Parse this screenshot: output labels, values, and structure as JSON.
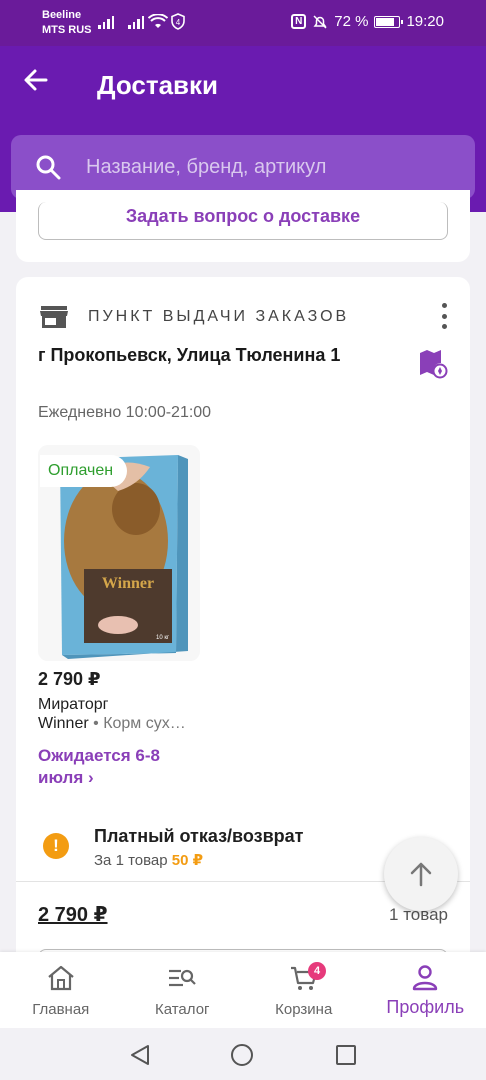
{
  "status_bar": {
    "carrier_1": "Beeline",
    "carrier_2": "MTS RUS",
    "battery": "72 %",
    "time": "19:20",
    "battery_level": 0.72
  },
  "header": {
    "title": "Доставки",
    "search_placeholder": "Название, бренд, артикул"
  },
  "prev_card": {
    "ask_button": "Задать вопрос о доставке"
  },
  "pickup": {
    "label": "ПУНКТ ВЫДАЧИ ЗАКАЗОВ",
    "address": "г Прокопьевск, Улица Тюленина 1",
    "schedule": "Ежедневно 10:00-21:00",
    "item": {
      "status": "Оплачен",
      "price": "2 790 ₽",
      "brand": "Мираторг",
      "name": "Winner",
      "name_sub": "• Корм сух…",
      "delivery": "Ожидается 6-8 июля ›",
      "package_brand": "Winner",
      "package_weight": "10 кг"
    },
    "refund": {
      "title": "Платный отказ/возврат",
      "prefix": "За 1 товар",
      "amount": "50 ₽"
    },
    "total": "2 790 ₽",
    "count": "1 товар"
  },
  "bottom_nav": {
    "items": [
      {
        "label": "Главная",
        "icon": "home-icon"
      },
      {
        "label": "Каталог",
        "icon": "catalog-icon"
      },
      {
        "label": "Корзина",
        "icon": "cart-icon",
        "badge": "4"
      },
      {
        "label": "Профиль",
        "icon": "profile-icon",
        "active": true
      }
    ]
  },
  "colors": {
    "brand": "#6a1bb0",
    "accent": "#8a3fb8",
    "paid": "#2e9e2e",
    "warning": "#f39c12"
  }
}
